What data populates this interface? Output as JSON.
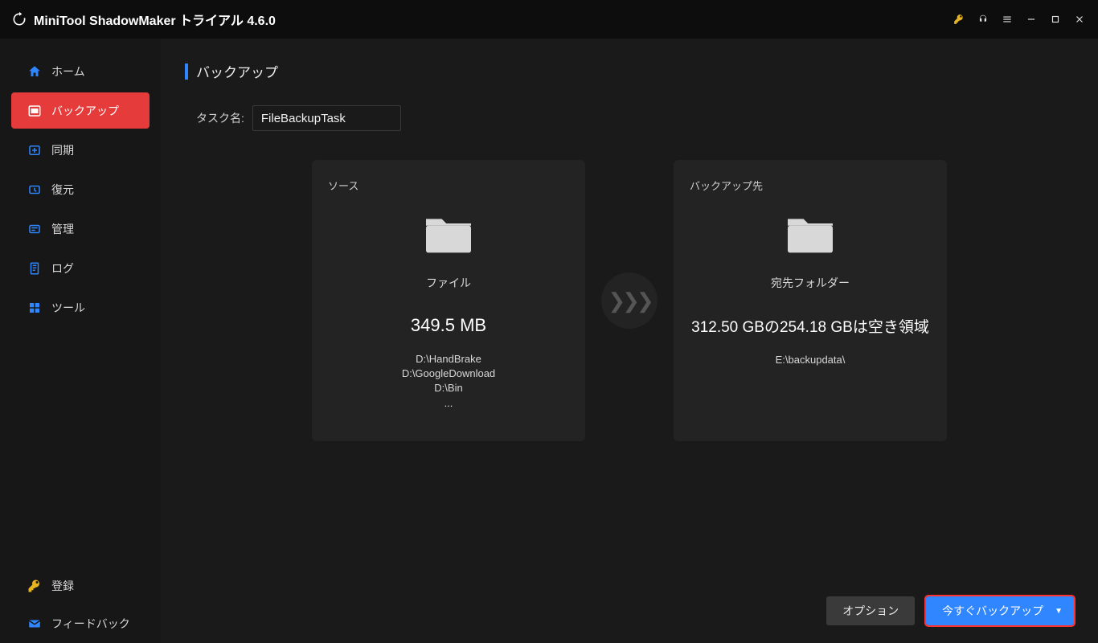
{
  "app": {
    "title": "MiniTool ShadowMaker トライアル 4.6.0"
  },
  "sidebar": {
    "items": [
      {
        "label": "ホーム"
      },
      {
        "label": "バックアップ"
      },
      {
        "label": "同期"
      },
      {
        "label": "復元"
      },
      {
        "label": "管理"
      },
      {
        "label": "ログ"
      },
      {
        "label": "ツール"
      }
    ],
    "register": "登録",
    "feedback": "フィードバック"
  },
  "page": {
    "title": "バックアップ",
    "task_label": "タスク名:",
    "task_value": "FileBackupTask"
  },
  "source": {
    "caption": "ソース",
    "type_label": "ファイル",
    "size": "349.5 MB",
    "paths": [
      "D:\\HandBrake",
      "D:\\GoogleDownload",
      "D:\\Bin",
      "..."
    ]
  },
  "destination": {
    "caption": "バックアップ先",
    "type_label": "宛先フォルダー",
    "space": "312.50 GBの254.18 GBは空き領域",
    "path": "E:\\backupdata\\"
  },
  "footer": {
    "options": "オプション",
    "backup_now": "今すぐバックアップ"
  }
}
